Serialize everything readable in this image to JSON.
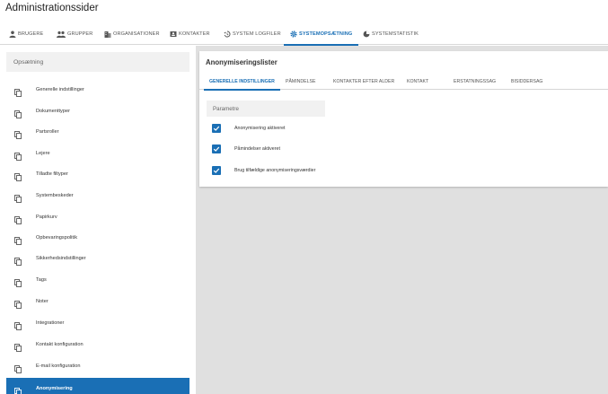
{
  "page": {
    "title": "Administrationssider"
  },
  "top_tabs": [
    {
      "label": "BRUGERE",
      "icon": "person-icon"
    },
    {
      "label": "GRUPPER",
      "icon": "group-icon"
    },
    {
      "label": "ORGANISATIONER",
      "icon": "organization-icon"
    },
    {
      "label": "KONTAKTER",
      "icon": "contact-card-icon"
    },
    {
      "label": "SYSTEM LOGFILER",
      "icon": "history-icon"
    },
    {
      "label": "SYSTEMOPSÆTNING",
      "icon": "gear-icon",
      "active": true
    },
    {
      "label": "SYSTEMSTATISTIK",
      "icon": "pie-chart-icon"
    }
  ],
  "sidebar": {
    "header": "Opsætning",
    "items": [
      {
        "label": "Generelle indstillinger"
      },
      {
        "label": "Dokumenttyper"
      },
      {
        "label": "Partsroller"
      },
      {
        "label": "Lejere"
      },
      {
        "label": "Tilladte filtyper"
      },
      {
        "label": "Systembeskeder"
      },
      {
        "label": "Papirkurv"
      },
      {
        "label": "Opbevaringspolitik"
      },
      {
        "label": "Sikkerhedsindstillinger"
      },
      {
        "label": "Tags"
      },
      {
        "label": "Noter"
      },
      {
        "label": "Integrationer"
      },
      {
        "label": "Kontakt konfiguration"
      },
      {
        "label": "E-mail konfiguration"
      },
      {
        "label": "Anonymisering",
        "active": true
      }
    ]
  },
  "panel": {
    "title": "Anonymiseringslister",
    "tabs": [
      {
        "label": "GENERELLE INDSTILLINGER",
        "active": true
      },
      {
        "label": "PÅMINDELSE"
      },
      {
        "label": "KONTAKTER EFTER ALDER"
      },
      {
        "label": "KONTAKT"
      },
      {
        "label": "ERSTATNINGSSAG"
      },
      {
        "label": "BISIDDERSAG"
      }
    ],
    "params_header": "Parametre",
    "checkboxes": [
      {
        "label": "Anonymisering aktiveret",
        "checked": true
      },
      {
        "label": "Påmindelser aktiveret",
        "checked": true
      },
      {
        "label": "Brug tilfældige anonymiseringsværdier",
        "checked": true
      }
    ]
  },
  "colors": {
    "accent": "#1a6fb5",
    "sidebar_active_bg": "#1a6fb5",
    "content_bg": "#e0e0e0"
  }
}
